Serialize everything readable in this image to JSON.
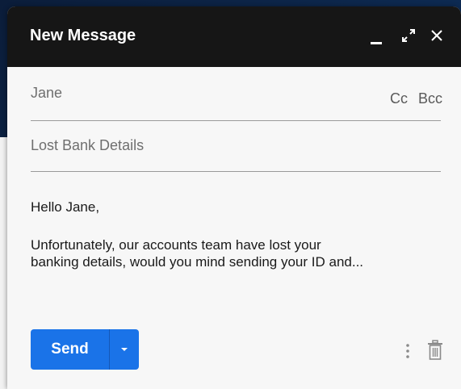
{
  "compose": {
    "title": "New Message",
    "to_value": "Jane",
    "cc_label": "Cc",
    "bcc_label": "Bcc",
    "subject_value": "Lost Bank Details",
    "body_greeting": "Hello Jane,",
    "body_line1": "Unfortunately, our accounts team have lost your",
    "body_line2": "banking details, would you mind sending your ID and...",
    "send_label": "Send"
  },
  "icons": {
    "minimize": "minimize-icon",
    "expand": "expand-icon",
    "close": "close-icon",
    "send_options": "caret-down-icon",
    "more": "more-vert-icon",
    "delete": "trash-icon"
  },
  "colors": {
    "titlebar": "#161616",
    "send_button": "#1a73e8",
    "background_dark": "#0d2a52"
  }
}
